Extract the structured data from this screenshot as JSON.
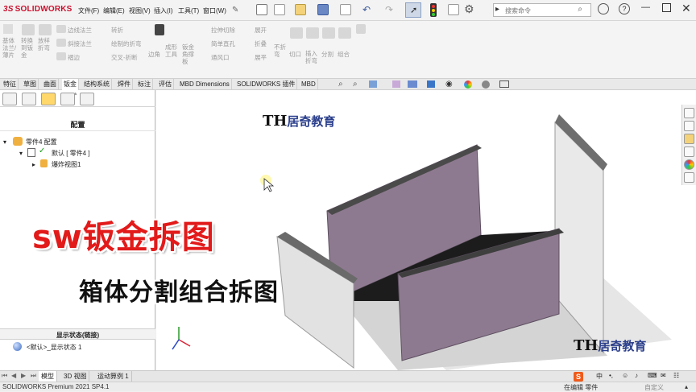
{
  "app": {
    "logo": "SOLIDWORKS",
    "logo_mark": "3S"
  },
  "menu": {
    "items": [
      "文件(F)",
      "编辑(E)",
      "视图(V)",
      "插入(I)",
      "工具(T)",
      "窗口(W)"
    ]
  },
  "search": {
    "placeholder": "搜索命令"
  },
  "ribbon": {
    "groups": [
      {
        "label": "基体\n法兰/\n薄片"
      },
      {
        "label": "转换\n到钣\n金"
      },
      {
        "label": "放样\n折弯"
      },
      {
        "label": "边线法兰"
      },
      {
        "label": "斜接法兰"
      },
      {
        "label": "褶边"
      },
      {
        "label": "转折"
      },
      {
        "label": "绘制的折弯"
      },
      {
        "label": "交叉-折断"
      },
      {
        "label": "边角"
      },
      {
        "label": "成形\n工具"
      },
      {
        "label": "钣金\n角撑\n板"
      },
      {
        "label": "拉伸切除"
      },
      {
        "label": "简单直孔"
      },
      {
        "label": "通风口"
      },
      {
        "label": "展开"
      },
      {
        "label": "折叠"
      },
      {
        "label": "展平"
      },
      {
        "label": "不折\n弯"
      },
      {
        "label": "切口"
      },
      {
        "label": "插入\n折弯"
      },
      {
        "label": "分割"
      },
      {
        "label": "组合"
      }
    ]
  },
  "tabs": [
    "特征",
    "草图",
    "曲面",
    "钣金",
    "结构系统",
    "焊件",
    "标注",
    "评估",
    "MBD Dimensions",
    "SOLIDWORKS 插件",
    "MBD"
  ],
  "active_tab": "钣金",
  "config_panel": {
    "header": "配置",
    "root": "零件4 配置",
    "config": "默认 [ 零件4 ]",
    "explode": "爆炸视图1",
    "display_state_header": "显示状态(链接)",
    "display_state": "<默认>_显示状态 1"
  },
  "overlay": {
    "title": "sw钣金拆图",
    "subtitle": "箱体分割组合拆图",
    "watermark": "居奇教育",
    "watermark_mark": "TH"
  },
  "bottom_tabs": [
    "模型",
    "3D 视图",
    "运动算例 1"
  ],
  "active_bottom_tab": "模型",
  "status": {
    "version": "SOLIDWORKS Premium 2021 SP4.1",
    "editing": "在编辑 零件",
    "custom": "自定义"
  },
  "colors": {
    "brand": "#c8102e",
    "panel_face": "#8e7a90",
    "title_red": "#e21a1a",
    "watermark": "#2b3f8c"
  },
  "icons": [
    "home-icon",
    "new-doc-icon",
    "open-icon",
    "save-icon",
    "print-icon",
    "undo-icon",
    "redo-icon",
    "select-icon",
    "traffic-light-icon",
    "options-icon",
    "gear-icon",
    "search-icon",
    "user-icon",
    "help-icon",
    "minimize-icon",
    "restore-icon",
    "close-icon"
  ]
}
